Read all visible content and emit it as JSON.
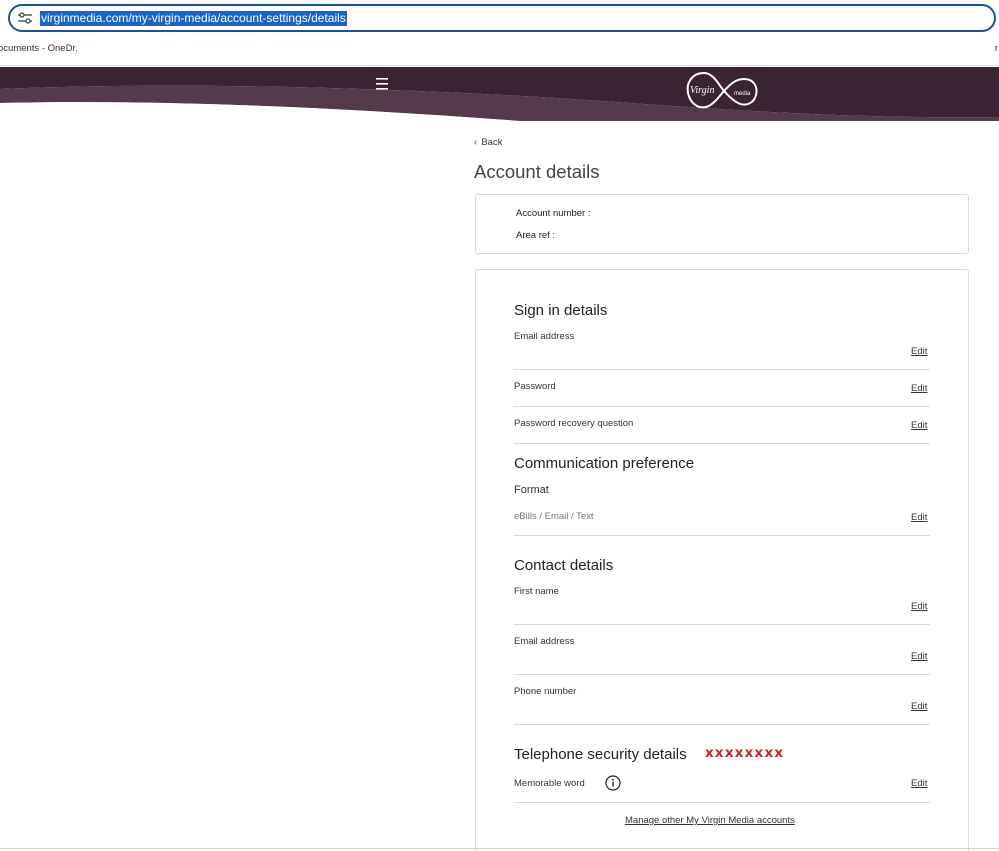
{
  "browser": {
    "url": "virginmedia.com/my-virgin-media/account-settings/details",
    "bookmark_left": "ocuments - OneDr.",
    "bookmark_right": "r"
  },
  "header": {
    "logo_text": "Virgin",
    "logo_sub": "media",
    "menu_icon": "hamburger-menu-icon",
    "bg_color": "#3a2433"
  },
  "back_label": "Back",
  "page_title": "Account details",
  "account": {
    "number_label": "Account number :",
    "area_label": "Area ref :"
  },
  "sign_in": {
    "title": "Sign in details",
    "email_label": "Email address",
    "password_label": "Password",
    "recovery_label": "Password recovery question",
    "edit": "Edit"
  },
  "communication": {
    "title": "Communication preference",
    "format_label": "Format",
    "format_value": "eBills / Email / Text",
    "edit": "Edit"
  },
  "contact": {
    "title": "Contact details",
    "first_name_label": "First name",
    "email_label": "Email address",
    "phone_label": "Phone number",
    "edit": "Edit"
  },
  "telephone": {
    "title": "Telephone security details",
    "masked": "xxxxxxxx",
    "memorable_label": "Memorable word",
    "edit": "Edit",
    "masked_color": "#c4252b"
  },
  "manage_link": "Manage other My Virgin Media accounts"
}
